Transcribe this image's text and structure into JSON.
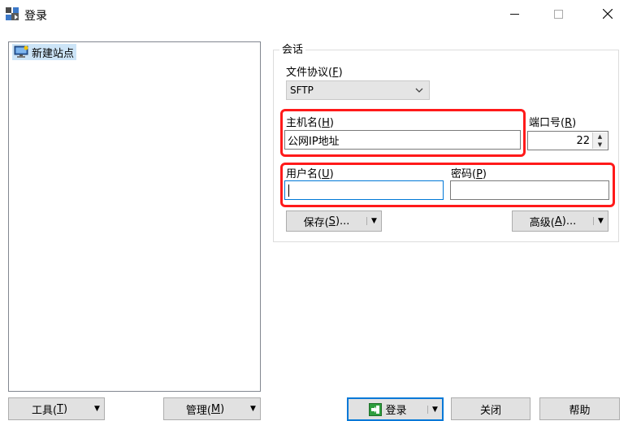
{
  "window": {
    "title": "登录",
    "controls": {
      "minimize": "—",
      "maximize": "☐",
      "close": "✕"
    }
  },
  "tree": {
    "items": [
      {
        "label": "新建站点",
        "selected": true
      }
    ]
  },
  "session": {
    "legend": "会话",
    "protocol": {
      "label": "文件协议(",
      "key": "F",
      "suffix": ")",
      "value": "SFTP"
    },
    "host": {
      "label": "主机名(",
      "key": "H",
      "suffix": ")",
      "value": "公网IP地址"
    },
    "port": {
      "label": "端口号(",
      "key": "R",
      "suffix": ")",
      "value": "22"
    },
    "user": {
      "label": "用户名(",
      "key": "U",
      "suffix": ")",
      "value": ""
    },
    "password": {
      "label": "密码(",
      "key": "P",
      "suffix": ")",
      "value": ""
    },
    "save": {
      "label": "保存(",
      "key": "S",
      "suffix": ")..."
    },
    "advanced": {
      "label": "高级(",
      "key": "A",
      "suffix": ")..."
    }
  },
  "bottom": {
    "tools": {
      "label": "工具(",
      "key": "T",
      "suffix": ")"
    },
    "manage": {
      "label": "管理(",
      "key": "M",
      "suffix": ")"
    },
    "login": {
      "label": "登录"
    },
    "close": {
      "label": "关闭"
    },
    "help": {
      "label": "帮助"
    }
  },
  "colors": {
    "highlight": "#ff1a1a",
    "focus": "#0078d7",
    "selection": "#cce4f7"
  },
  "icons": {
    "app": "winscp-app-icon",
    "site": "computer-monitor-icon",
    "login": "login-arrow-icon",
    "dropdown": "triangle-down-icon"
  }
}
